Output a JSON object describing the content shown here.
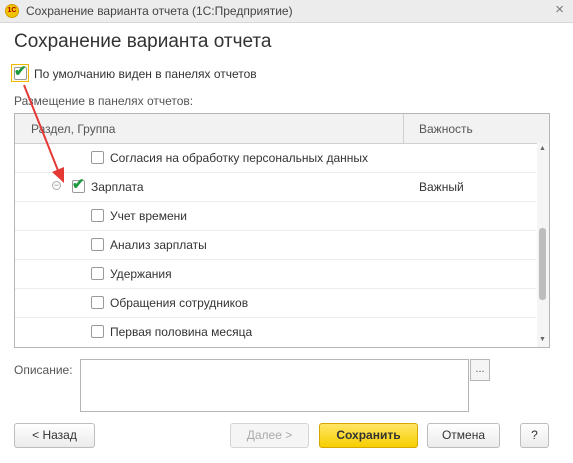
{
  "window": {
    "logo": "1С",
    "title": "Сохранение варианта отчета  (1С:Предприятие)",
    "close_glyph": "×"
  },
  "form": {
    "title": "Сохранение варианта отчета",
    "default_visible_label": "По умолчанию виден в панелях отчетов",
    "placement_label": "Размещение в панелях отчетов:"
  },
  "tree": {
    "headers": {
      "section": "Раздел, Группа",
      "importance": "Важность"
    },
    "rows": [
      {
        "label": "Согласия на обработку персональных данных",
        "checked": false,
        "importance": ""
      },
      {
        "label": "Зарплата",
        "checked": true,
        "importance": "Важный"
      },
      {
        "label": "Учет времени",
        "checked": false,
        "importance": ""
      },
      {
        "label": "Анализ зарплаты",
        "checked": false,
        "importance": ""
      },
      {
        "label": "Удержания",
        "checked": false,
        "importance": ""
      },
      {
        "label": "Обращения сотрудников",
        "checked": false,
        "importance": ""
      },
      {
        "label": "Первая половина месяца",
        "checked": false,
        "importance": ""
      }
    ],
    "collapse_glyph": "−"
  },
  "description": {
    "label": "Описание:",
    "value": "",
    "select_button_label": "..."
  },
  "buttons": {
    "back": "< Назад",
    "next": "Далее >",
    "save": "Сохранить",
    "cancel": "Отмена",
    "help": "?"
  },
  "colors": {
    "accent_yellow": "#f7cf00",
    "check_green": "#1f9a3c",
    "arrow_red": "#e53935"
  },
  "glyphs": {
    "check": "✔"
  }
}
